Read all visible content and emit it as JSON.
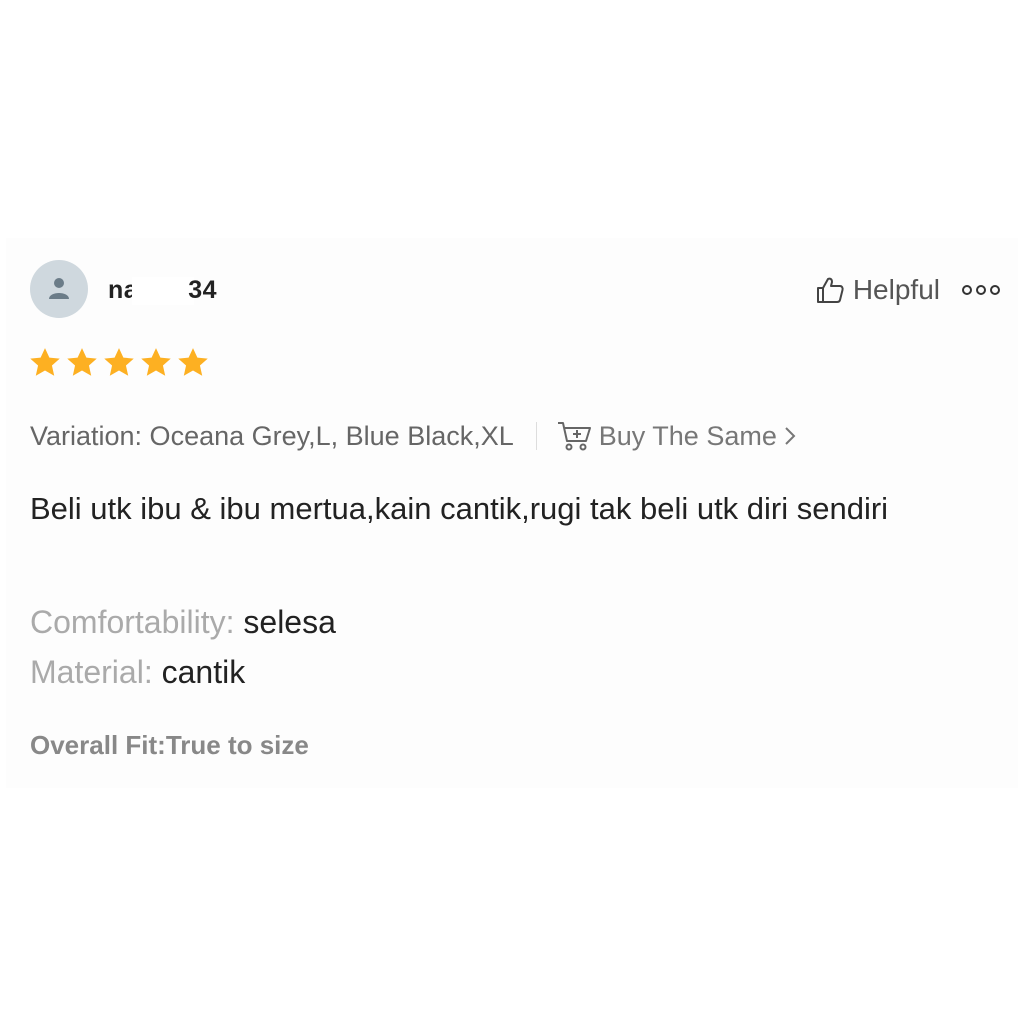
{
  "review": {
    "user": {
      "name_start": "na",
      "name_end": "34",
      "avatar_icon": "person-icon"
    },
    "helpful_label": "Helpful",
    "helpful_icon": "thumbs-up-icon",
    "more_icon": "more-options-icon",
    "rating": 5,
    "rating_max": 5,
    "star_color": "#FDB022",
    "variation": "Variation: Oceana Grey,L, Blue Black,XL",
    "buy_same_label": "Buy The Same",
    "buy_same_icon": "cart-add-icon",
    "chevron_icon": "chevron-right-icon",
    "comment": "Beli utk ibu & ibu mertua,kain cantik,rugi tak beli utk diri sendiri",
    "attributes": [
      {
        "label": "Comfortability:",
        "value": "selesa"
      },
      {
        "label": "Material:",
        "value": "cantik"
      }
    ],
    "overall_fit": "Overall Fit:True to size"
  }
}
